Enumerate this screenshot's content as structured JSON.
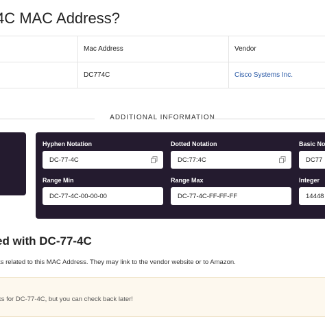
{
  "page": {
    "title": "4C MAC Address?"
  },
  "table": {
    "headers": [
      "",
      "Mac Address",
      "Vendor"
    ],
    "row": {
      "col0": "",
      "mac": "DC774C",
      "vendor": "Cisco Systems Inc."
    }
  },
  "additional": {
    "heading": "ADDITIONAL INFORMATION",
    "fields": [
      {
        "label": "Hyphen Notation",
        "value": "DC-77-4C"
      },
      {
        "label": "Dotted Notation",
        "value": "DC:77:4C"
      },
      {
        "label": "Basic Not",
        "value": "DC77"
      },
      {
        "label": "Range Min",
        "value": "DC-77-4C-00-00-00"
      },
      {
        "label": "Range Max",
        "value": "DC-77-4C-FF-FF-FF"
      },
      {
        "label": "Integer",
        "value": "14448"
      }
    ],
    "copy_icon": "copy-icon"
  },
  "related": {
    "heading": "ed with DC-77-4C",
    "description": "ks related to this MAC Address. They may link to the vendor website or to Amazon.",
    "notice": "ks for DC-77-4C, but you can check back later!"
  },
  "colors": {
    "panel_bg": "#241b2f",
    "link": "#2b5aa6",
    "notice_bg": "#fdf8ee"
  }
}
